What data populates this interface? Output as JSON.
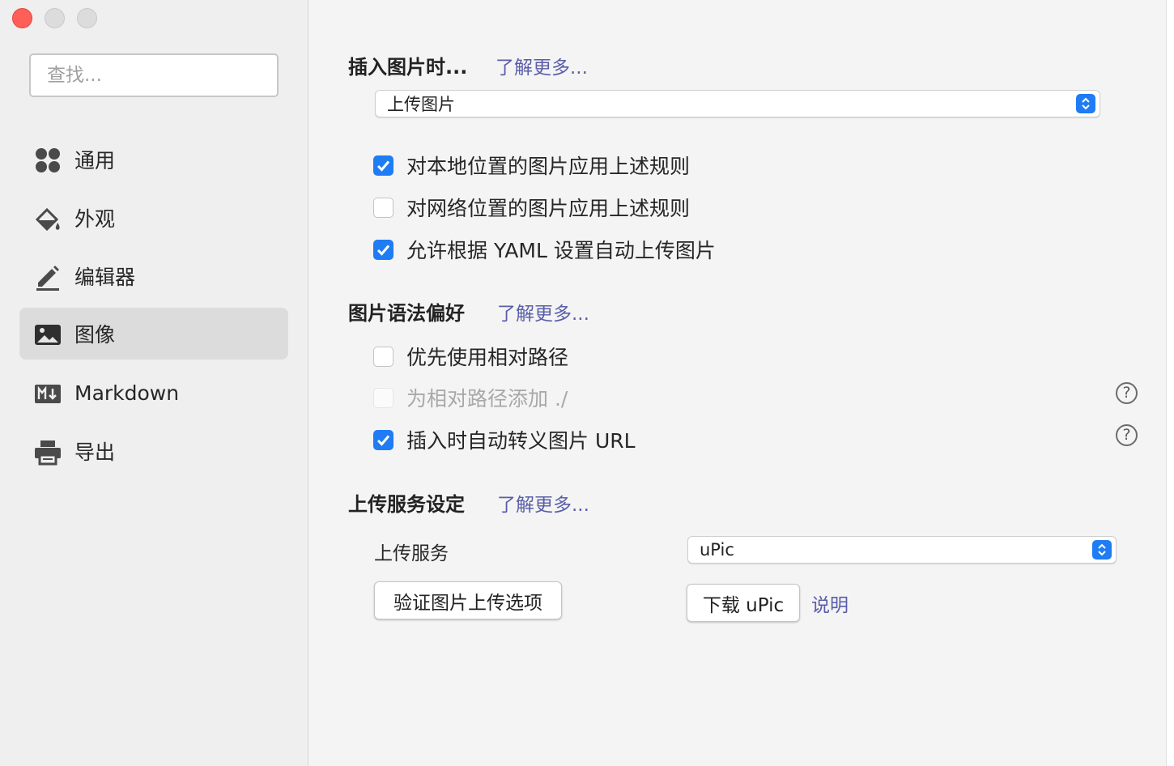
{
  "window": {
    "title": ""
  },
  "sidebar": {
    "search_placeholder": "查找...",
    "items": [
      {
        "label": "通用",
        "icon": "grid-dots-icon",
        "active": false
      },
      {
        "label": "外观",
        "icon": "paint-bucket-icon",
        "active": false
      },
      {
        "label": "编辑器",
        "icon": "pencil-icon",
        "active": false
      },
      {
        "label": "图像",
        "icon": "image-icon",
        "active": true
      },
      {
        "label": "Markdown",
        "icon": "markdown-icon",
        "active": false
      },
      {
        "label": "导出",
        "icon": "printer-icon",
        "active": false
      }
    ]
  },
  "main": {
    "insert_section": {
      "title": "插入图片时...",
      "learn_more": "了解更多...",
      "select_value": "上传图片",
      "options": [
        {
          "label": "对本地位置的图片应用上述规则",
          "checked": true
        },
        {
          "label": "对网络位置的图片应用上述规则",
          "checked": false
        },
        {
          "label": "允许根据 YAML 设置自动上传图片",
          "checked": true
        }
      ]
    },
    "syntax_section": {
      "title": "图片语法偏好",
      "learn_more": "了解更多...",
      "options": [
        {
          "label": "优先使用相对路径",
          "checked": false,
          "disabled": false
        },
        {
          "label": "为相对路径添加 ./",
          "checked": false,
          "disabled": true,
          "help": "?"
        },
        {
          "label": "插入时自动转义图片 URL",
          "checked": true,
          "disabled": false,
          "help": "?"
        }
      ]
    },
    "upload_section": {
      "title": "上传服务设定",
      "learn_more": "了解更多...",
      "service_label": "上传服务",
      "service_value": "uPic",
      "verify_button": "验证图片上传选项",
      "download_button": "下载 uPic",
      "explain_link": "说明"
    }
  },
  "colors": {
    "accent": "#1f7cf4",
    "link": "#5a5ea8",
    "close": "#ff5f57",
    "sidebar_active": "#dcdcdc"
  }
}
